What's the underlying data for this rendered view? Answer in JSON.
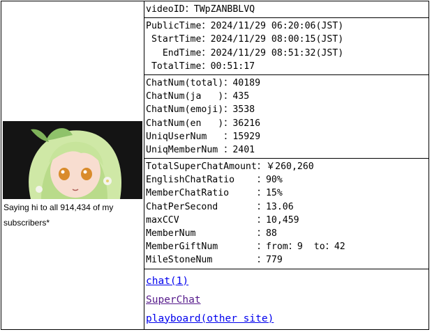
{
  "thumbnail": {
    "alt_colors": {
      "bg": "#1a1a1a",
      "hair": "#c8e6a0",
      "skin": "#f7ddd0",
      "eye": "#d98b2b"
    }
  },
  "caption": "Saying hi to all 914,434 of my subscribers*",
  "video": {
    "id_label": "videoID",
    "id_sep": "：",
    "id_value": "TWpZANBBLVQ"
  },
  "times": [
    {
      "label": "PublicTime",
      "sep": "：",
      "value": "2024/11/29 06:20:06(JST)"
    },
    {
      "label": " StartTime",
      "sep": "：",
      "value": "2024/11/29 08:00:15(JST)"
    },
    {
      "label": "   EndTime",
      "sep": "：",
      "value": "2024/11/29 08:51:32(JST)"
    },
    {
      "label": " TotalTime",
      "sep": "：",
      "value": "00:51:17"
    }
  ],
  "chat": [
    {
      "label": "ChatNum(total)",
      "sep": "：",
      "value": "40189"
    },
    {
      "label": "ChatNum(ja   )",
      "sep": "：",
      "value": "435"
    },
    {
      "label": "ChatNum(emoji)",
      "sep": "：",
      "value": "3538"
    },
    {
      "label": "ChatNum(en   )",
      "sep": "：",
      "value": "36216"
    },
    {
      "label": "UniqUserNum   ",
      "sep": "：",
      "value": "15929"
    },
    {
      "label": "UniqMemberNum ",
      "sep": "：",
      "value": "2401"
    }
  ],
  "stats": [
    {
      "label": "TotalSuperChatAmount",
      "sep": "：",
      "value": "￥260,260"
    },
    {
      "label": "EnglishChatRatio    ",
      "sep": "：",
      "value": "90%"
    },
    {
      "label": "MemberChatRatio     ",
      "sep": "：",
      "value": "15%"
    },
    {
      "label": "ChatPerSecond       ",
      "sep": "：",
      "value": "13.06"
    },
    {
      "label": "maxCCV              ",
      "sep": "：",
      "value": "10,459"
    },
    {
      "label": "MemberNum           ",
      "sep": "：",
      "value": "88"
    },
    {
      "label": "MemberGiftNum       ",
      "sep": "：",
      "value": "from：9  to：42"
    },
    {
      "label": "MileStoneNum        ",
      "sep": "：",
      "value": "779"
    }
  ],
  "links": [
    {
      "label": "chat(1)"
    },
    {
      "label": "SuperChat"
    },
    {
      "label": "playboard(other site)"
    }
  ]
}
